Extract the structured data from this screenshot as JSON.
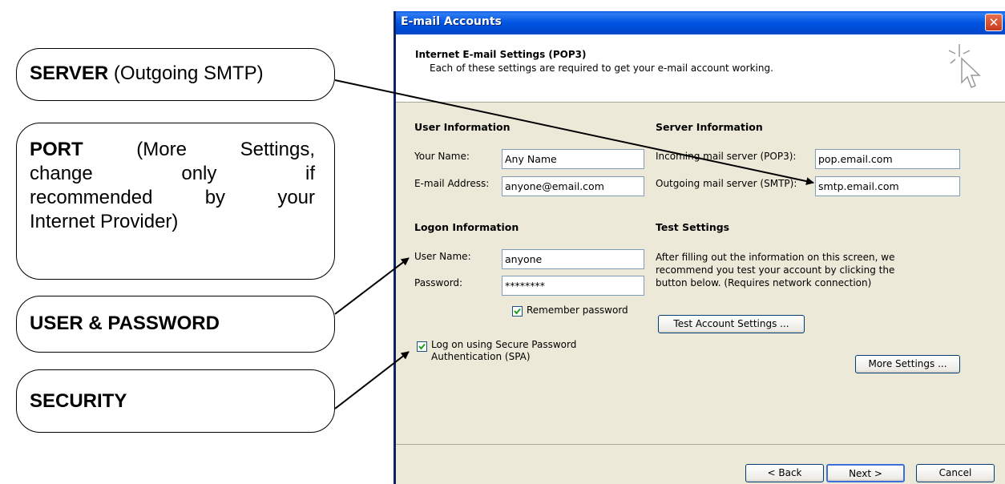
{
  "callouts": {
    "server_bold": "SERVER",
    "server_rest": " (Outgoing SMTP)",
    "port_bold": "PORT",
    "port_line1_rest": " (More Settings,",
    "port_line2": "change only if",
    "port_line3": "recommended by your",
    "port_line4": "Internet Provider)",
    "user_password": "USER & PASSWORD",
    "security": "SECURITY"
  },
  "dialog": {
    "title": "E-mail Accounts",
    "close_glyph": "✕",
    "header_title": "Internet E-mail Settings (POP3)",
    "header_subtitle": "Each of these settings are required to get your e-mail account working."
  },
  "user_info": {
    "heading": "User Information",
    "name_label": "Your Name:",
    "name_value": "Any Name",
    "email_label": "E-mail Address:",
    "email_value": "anyone@email.com"
  },
  "server_info": {
    "heading": "Server Information",
    "incoming_label": "Incoming mail server (POP3):",
    "incoming_value": "pop.email.com",
    "outgoing_label": "Outgoing mail server (SMTP):",
    "outgoing_value": "smtp.email.com"
  },
  "logon_info": {
    "heading": "Logon Information",
    "user_label": "User Name:",
    "user_value": "anyone",
    "password_label": "Password:",
    "password_value": "********",
    "remember_label": "Remember password",
    "remember_checked": true,
    "spa_label_line1": "Log on using Secure Password",
    "spa_label_line2": "Authentication (SPA)",
    "spa_checked": true
  },
  "test_settings": {
    "heading": "Test Settings",
    "desc_line1": "After filling out the information on this screen, we",
    "desc_line2": "recommend you test your account by clicking the",
    "desc_line3": "button below. (Requires network connection)",
    "test_button": "Test Account Settings ...",
    "more_button": "More Settings ..."
  },
  "footer": {
    "back": "< Back",
    "next": "Next >",
    "cancel": "Cancel"
  },
  "colors": {
    "titlebar": "#0054E3",
    "dialog_bg": "#ECE9D8",
    "field_border": "#7F9DB9",
    "check_green": "#21A121"
  }
}
